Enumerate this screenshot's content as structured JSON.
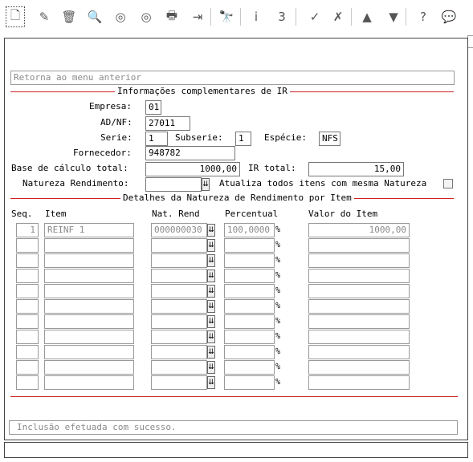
{
  "toolbar": {
    "buttons": [
      {
        "name": "new-document-icon",
        "glyph": "🗋"
      },
      {
        "name": "edit-icon",
        "glyph": "✎"
      },
      {
        "name": "delete-icon",
        "glyph": "🗑"
      },
      {
        "name": "search-icon",
        "glyph": "🔍"
      },
      {
        "name": "previous-record-icon",
        "glyph": "◎"
      },
      {
        "name": "next-record-icon",
        "glyph": "◎"
      },
      {
        "name": "print-icon",
        "glyph": "🖶"
      },
      {
        "name": "exit-icon",
        "glyph": "⇥"
      },
      {
        "name": "find-icon",
        "glyph": "🔭"
      },
      {
        "name": "info-icon",
        "glyph": "i"
      },
      {
        "name": "zoom-icon",
        "glyph": "3"
      },
      {
        "name": "confirm-icon",
        "glyph": "✓"
      },
      {
        "name": "cancel-icon",
        "glyph": "✗"
      },
      {
        "name": "first-record-icon",
        "glyph": "▲"
      },
      {
        "name": "last-record-icon",
        "glyph": "▼"
      },
      {
        "name": "help-icon",
        "glyph": "?"
      },
      {
        "name": "comment-icon",
        "glyph": "💬"
      }
    ]
  },
  "back_menu": "Retorna ao menu anterior",
  "section1_title": "Informações complementares de IR",
  "form": {
    "empresa_label": "Empresa:",
    "empresa_value": "01",
    "adnf_label": "AD/NF:",
    "adnf_value": "27011",
    "serie_label": "Serie:",
    "serie_value": "1",
    "subserie_label": "Subserie:",
    "subserie_value": "1",
    "especie_label": "Espécie:",
    "especie_value": "NFS",
    "fornecedor_label": "Fornecedor:",
    "fornecedor_value": "948782",
    "base_label": "Base de cálculo total:",
    "base_value": "1000,00",
    "ir_label": "IR total:",
    "ir_value": "15,00",
    "natureza_label": "Natureza Rendimento:",
    "natureza_value": "",
    "atualiza_label": "Atualiza todos itens com mesma Natureza"
  },
  "section2_title": "Detalhes da Natureza de Rendimento por Item",
  "table": {
    "headers": {
      "seq": "Seq.",
      "item": "Item",
      "nat": "Nat. Rend",
      "pct": "Percentual",
      "valor": "Valor do Item"
    },
    "pct_symbol": "%",
    "rows": [
      {
        "seq": "1",
        "item": "REINF 1",
        "nat": "000000030",
        "pct": "100,0000",
        "valor": "1000,00"
      },
      {
        "seq": "",
        "item": "",
        "nat": "",
        "pct": "",
        "valor": ""
      },
      {
        "seq": "",
        "item": "",
        "nat": "",
        "pct": "",
        "valor": ""
      },
      {
        "seq": "",
        "item": "",
        "nat": "",
        "pct": "",
        "valor": ""
      },
      {
        "seq": "",
        "item": "",
        "nat": "",
        "pct": "",
        "valor": ""
      },
      {
        "seq": "",
        "item": "",
        "nat": "",
        "pct": "",
        "valor": ""
      },
      {
        "seq": "",
        "item": "",
        "nat": "",
        "pct": "",
        "valor": ""
      },
      {
        "seq": "",
        "item": "",
        "nat": "",
        "pct": "",
        "valor": ""
      },
      {
        "seq": "",
        "item": "",
        "nat": "",
        "pct": "",
        "valor": ""
      },
      {
        "seq": "",
        "item": "",
        "nat": "",
        "pct": "",
        "valor": ""
      },
      {
        "seq": "",
        "item": "",
        "nat": "",
        "pct": "",
        "valor": ""
      }
    ]
  },
  "status_message": "Inclusão efetuada com sucesso.",
  "colors": {
    "section_line": "#cc2222",
    "readonly_text": "#8a8a8a"
  }
}
